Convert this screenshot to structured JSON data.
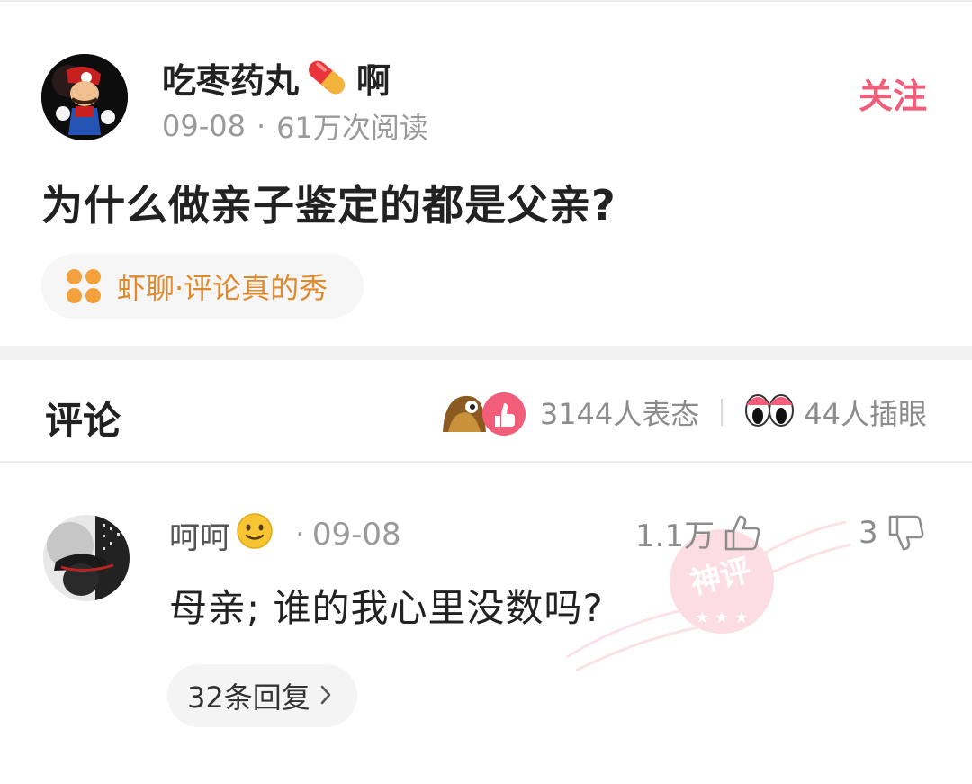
{
  "post": {
    "author": {
      "name": "吃枣药丸",
      "name_suffix": "啊",
      "date": "09-08",
      "views": "61万次阅读"
    },
    "follow_label": "关注",
    "title": "为什么做亲子鉴定的都是父亲?",
    "topic_label": "虾聊·评论真的秀"
  },
  "comments_section": {
    "title": "评论",
    "reactions_count": "3144人表态",
    "eyes_count": "44人插眼"
  },
  "comment": {
    "user": "呵呵",
    "date": "09-08",
    "likes": "1.1万",
    "dislikes": "3",
    "text": "母亲; 谁的我心里没数吗?",
    "replies_label": "32条回复",
    "badge": "神评"
  },
  "colors": {
    "accent": "#f25d7a",
    "topic": "#e08a2e",
    "muted": "#9a9a9a"
  }
}
